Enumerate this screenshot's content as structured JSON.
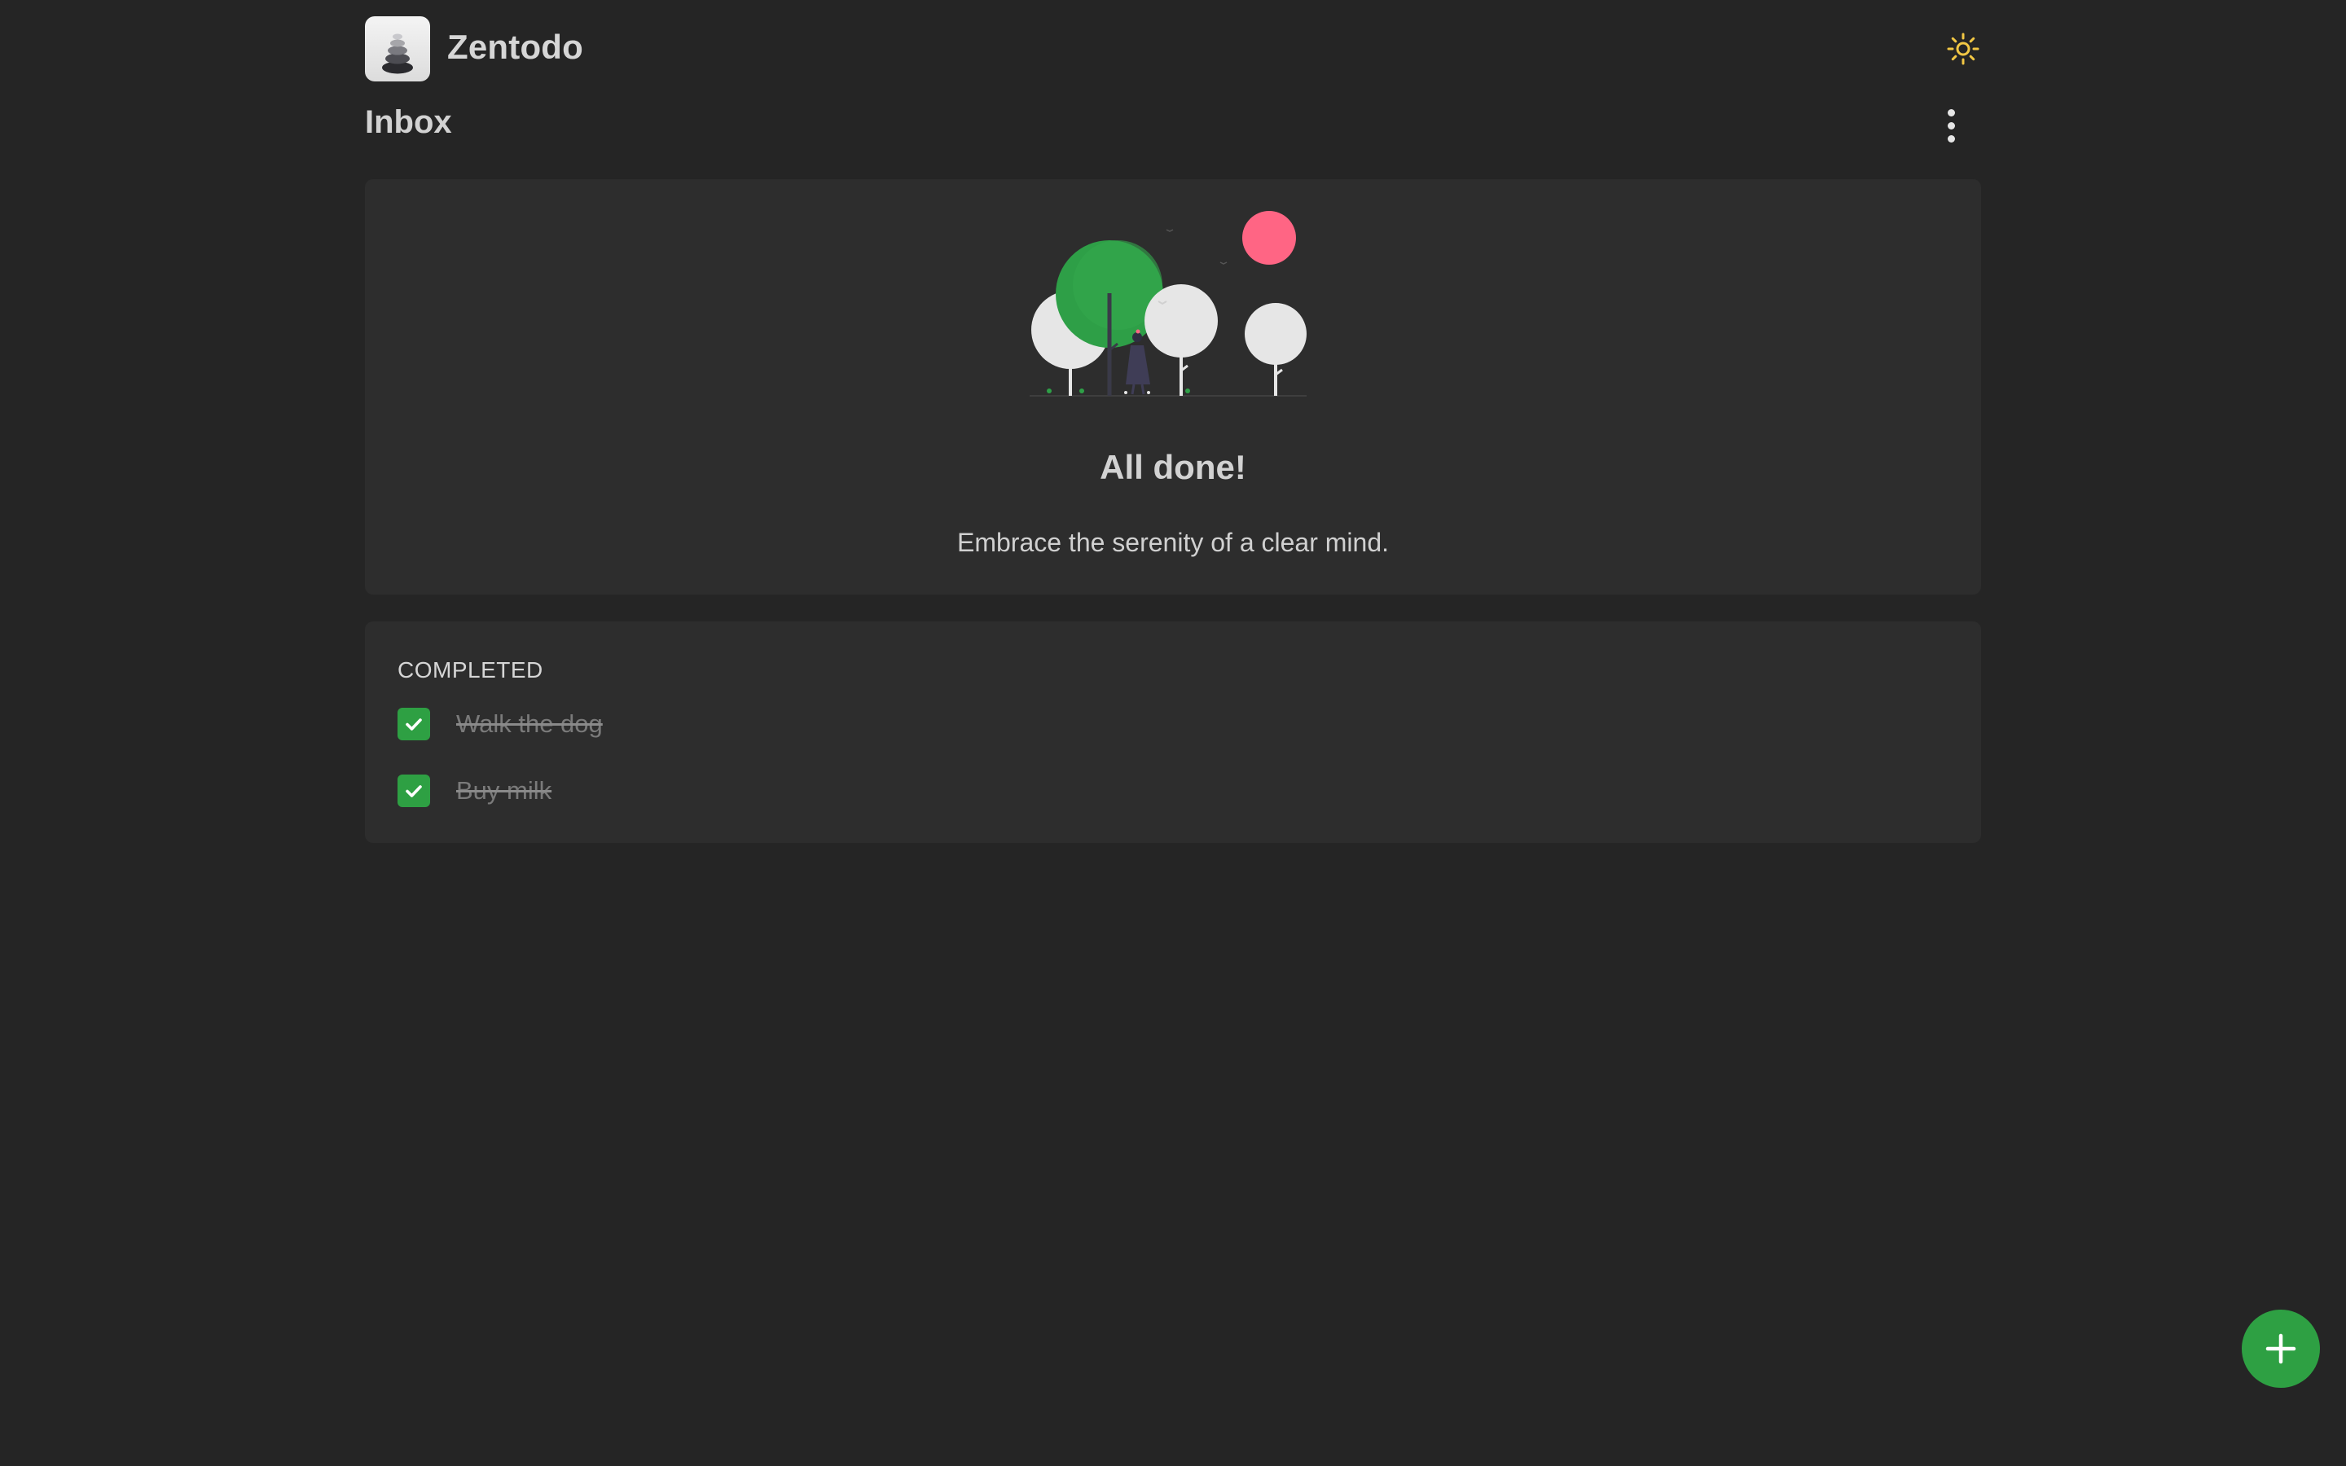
{
  "app": {
    "name": "Zentodo"
  },
  "header": {
    "logo_icon": "stacked-stones-icon",
    "theme_toggle_icon": "sun-icon",
    "theme_toggle_color": "#f2c744"
  },
  "page": {
    "title": "Inbox",
    "more_icon": "vertical-dots-icon"
  },
  "empty_state": {
    "illustration": "trees-and-person-illustration",
    "title": "All done!",
    "subtitle": "Embrace the serenity of a clear mind."
  },
  "completed": {
    "heading": "COMPLETED",
    "tasks": [
      {
        "label": "Walk the dog",
        "checked": true
      },
      {
        "label": "Buy milk",
        "checked": true
      }
    ]
  },
  "fab": {
    "icon": "plus-icon"
  },
  "colors": {
    "background": "#252525",
    "card": "#2d2d2d",
    "accent": "#2ea043",
    "sun": "#f2c744",
    "balloon": "#ff6584"
  }
}
